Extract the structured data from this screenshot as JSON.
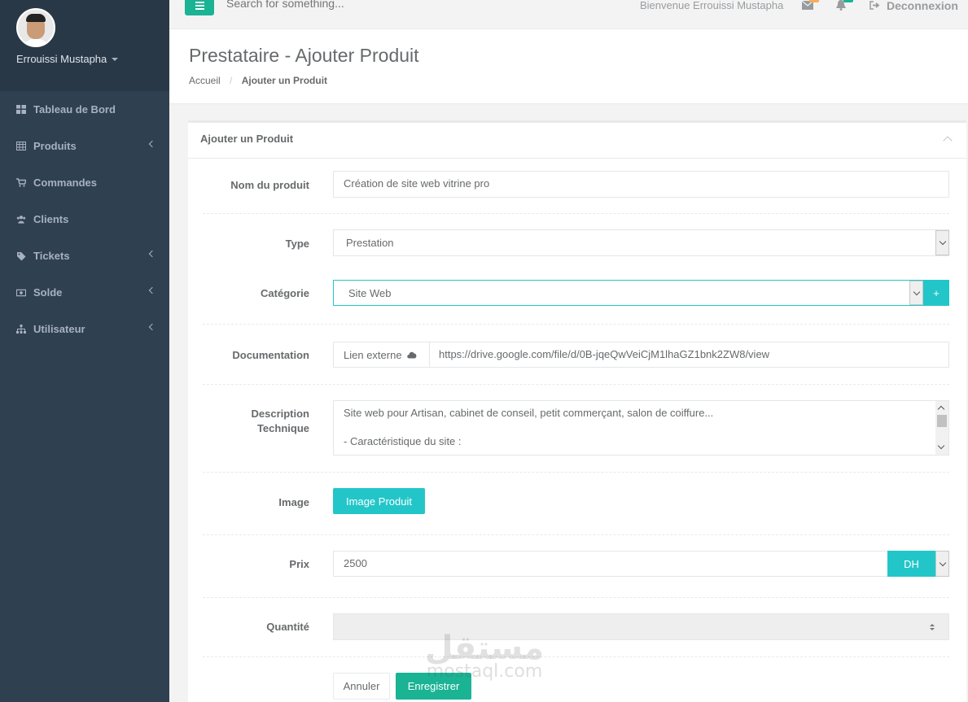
{
  "sidebar": {
    "profile_name": "Errouissi Mustapha",
    "items": [
      {
        "label": "Tableau de Bord",
        "icon": "dashboard-icon",
        "has_arrow": false
      },
      {
        "label": "Produits",
        "icon": "table-icon",
        "has_arrow": true
      },
      {
        "label": "Commandes",
        "icon": "cart-icon",
        "has_arrow": false
      },
      {
        "label": "Clients",
        "icon": "users-icon",
        "has_arrow": false
      },
      {
        "label": "Tickets",
        "icon": "tag-icon",
        "has_arrow": true
      },
      {
        "label": "Solde",
        "icon": "money-icon",
        "has_arrow": true
      },
      {
        "label": "Utilisateur",
        "icon": "sitemap-icon",
        "has_arrow": true
      }
    ]
  },
  "topbar": {
    "search_placeholder": "Search for something...",
    "welcome": "Bienvenue Errouissi Mustapha",
    "logout": "Deconnexion"
  },
  "heading": {
    "title": "Prestataire - Ajouter Produit",
    "breadcrumb_home": "Accueil",
    "breadcrumb_current": "Ajouter un Produit"
  },
  "form": {
    "panel_title": "Ajouter un Produit",
    "nom": {
      "label": "Nom du produit",
      "value": "Création de site web vitrine pro"
    },
    "type": {
      "label": "Type",
      "value": "Prestation"
    },
    "categorie": {
      "label": "Catégorie",
      "value": "Site Web",
      "add_label": "+"
    },
    "documentation": {
      "label": "Documentation",
      "addon": "Lien externe",
      "value": "https://drive.google.com/file/d/0B-jqeQwVeiCjM1lhaGZ1bnk2ZW8/view"
    },
    "description": {
      "label_line1": "Description",
      "label_line2": "Technique",
      "line1": "Site web pour Artisan, cabinet de conseil, petit commerçant, salon de coiffure...",
      "line2": "- Caractéristique du site :"
    },
    "image": {
      "label": "Image",
      "button": "Image Produit"
    },
    "prix": {
      "label": "Prix",
      "value": "2500",
      "currency": "DH"
    },
    "quantite": {
      "label": "Quantité",
      "value": ""
    },
    "cancel": "Annuler",
    "save": "Enregistrer"
  },
  "watermark": {
    "arabic": "مستقل",
    "latin": "mostaql.com"
  },
  "colors": {
    "sidebar": "#2f4050",
    "primary": "#1ab394",
    "info": "#23c6c8",
    "badge_warning": "#f8ac59"
  }
}
